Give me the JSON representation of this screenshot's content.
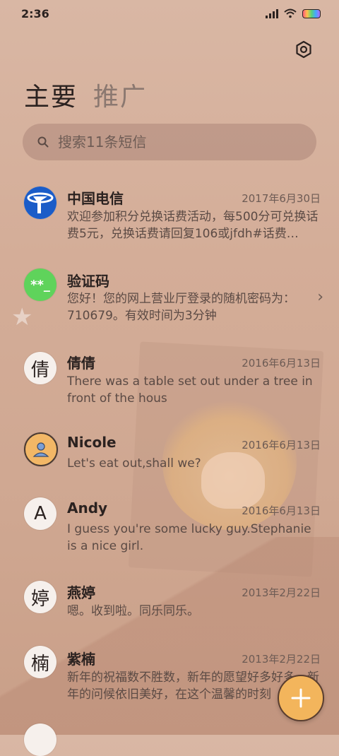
{
  "status": {
    "time": "2:36"
  },
  "tabs": [
    {
      "label": "主要"
    },
    {
      "label": "推广"
    }
  ],
  "search": {
    "placeholder": "搜索11条短信"
  },
  "conversations": [
    {
      "name": "中国电信",
      "date": "2017年6月30日",
      "preview": "欢迎参加积分兑换话费活动，每500分可兑换话费5元，兑换话费请回复106或jfdh#话费…",
      "avatar": "china-telecom-logo"
    },
    {
      "name": "验证码",
      "date": "",
      "preview": "您好！您的网上营业厅登录的随机密码为：710679。有效时间为3分钟",
      "avatar_text": "**_",
      "avatar_color": "#5fd35b"
    },
    {
      "name": "倩倩",
      "date": "2016年6月13日",
      "preview": "There was a table set out under a tree in front of the hous",
      "avatar_text": "倩"
    },
    {
      "name": "Nicole",
      "date": "2016年6月13日",
      "preview": "Let's eat out,shall we?",
      "avatar": "person-icon",
      "avatar_color": "#f2b766"
    },
    {
      "name": "Andy",
      "date": "2016年6月13日",
      "preview": "I guess you're some lucky guy.Stephanie is a nice girl.",
      "avatar_text": "A"
    },
    {
      "name": "燕婷",
      "date": "2013年2月22日",
      "preview": "嗯。收到啦。同乐同乐。",
      "avatar_text": "婷"
    },
    {
      "name": "紫楠",
      "date": "2013年2月22日",
      "preview": "新年的祝福数不胜数，新年的愿望好多好多，新年的问候依旧美好，在这个温馨的时刻",
      "avatar_text": "楠"
    }
  ],
  "colors": {
    "accent": "#f3b55c",
    "background": "#d4ad98"
  }
}
